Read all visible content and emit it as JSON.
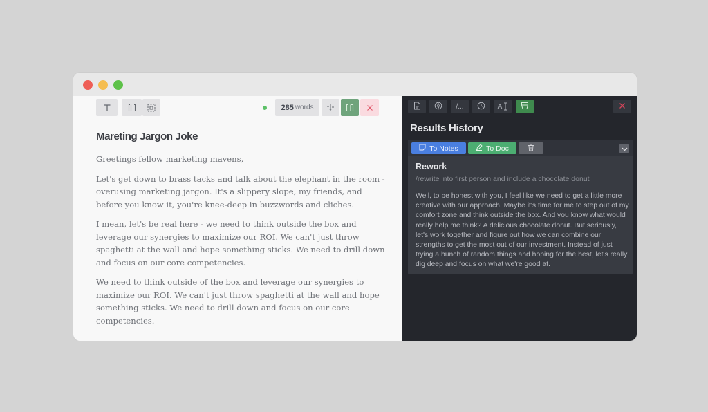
{
  "window": {
    "traffic_lights": [
      "close",
      "minimize",
      "maximize"
    ]
  },
  "editor": {
    "toolbar": {
      "text_format_icon": "type-icon",
      "layout_icon": "panel-layout-icon",
      "focus_icon": "focus-frame-icon",
      "status_color": "#5dc168",
      "word_count": "285",
      "word_unit": "words",
      "settings_icon": "sliders-icon",
      "split_view_icon": "split-view-icon",
      "close_icon": "close-icon"
    },
    "document": {
      "title": "Mareting Jargon Joke",
      "paragraphs": [
        "Greetings fellow marketing mavens,",
        "Let's get down to brass tacks and talk about the elephant in the room - overusing marketing jargon. It's a slippery slope, my friends, and before you know it, you're knee-deep in buzzwords and cliches.",
        "I mean, let's be real here - we need to think outside the box and leverage our synergies to maximize our ROI. We can't just throw spaghetti at the wall and hope something sticks. We need to drill down and focus on our core competencies.",
        "We need to think outside of the box and leverage our synergies to maximize our ROI. We can't just throw spaghetti at the wall and hope something sticks. We need to drill down and focus on our core competencies."
      ]
    }
  },
  "results": {
    "toolbar": {
      "tools": [
        {
          "icon": "document-icon",
          "label": ""
        },
        {
          "icon": "compass-icon",
          "label": ""
        },
        {
          "icon": "command-icon",
          "label": "/..."
        },
        {
          "icon": "history-icon",
          "label": ""
        },
        {
          "icon": "text-size-icon",
          "label": "A"
        },
        {
          "icon": "cup-icon",
          "label": ""
        }
      ],
      "active_index": 5
    },
    "title": "Results History",
    "card": {
      "to_notes_label": "To Notes",
      "to_doc_label": "To Doc",
      "title": "Rework",
      "command": "/rewrite into first person and include a chocolate donut",
      "text": "Well, to be honest with you, I feel like we need to get a little more creative with our approach. Maybe it's time for me to step out of my comfort zone and think outside the box. And you know what would really help me think? A delicious chocolate donut. But seriously, let's work together and figure out how we can combine our strengths to get the most out of our investment. Instead of just trying a bunch of random things and hoping for the best, let's really dig deep and focus on what we're good at."
    }
  },
  "colors": {
    "accent_green": "#3f8a4e",
    "notes_blue": "#4a7fe0",
    "doc_green": "#4cae72",
    "danger_red": "#d4455a"
  }
}
